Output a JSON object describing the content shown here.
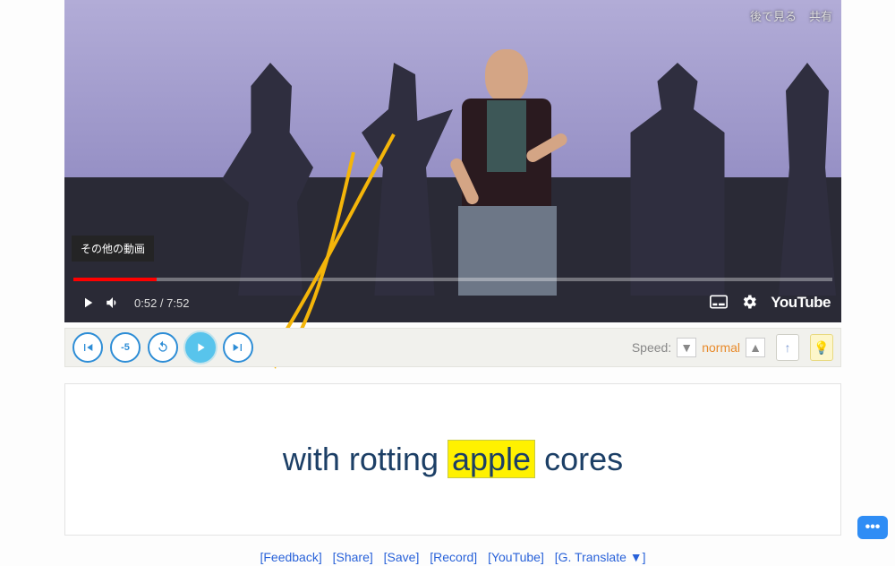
{
  "video": {
    "top_tags": {
      "watch_later": "後で見る",
      "share": "共有"
    },
    "more_videos": "その他の動画",
    "time_current": "0:52",
    "time_separator": " / ",
    "time_total": "7:52",
    "logo": "YouTube"
  },
  "controls": {
    "minus5": "-5",
    "speed_label": "Speed:",
    "speed_value": "normal",
    "up_arrow": "↑",
    "bulb": "💡",
    "dropdown_down": "▼",
    "dropdown_up": "▲"
  },
  "subtitle": {
    "pre": "with rotting ",
    "highlight": "apple",
    "post": " cores"
  },
  "footer": {
    "feedback": "[Feedback]",
    "share": "[Share]",
    "save": "[Save]",
    "record": "[Record]",
    "youtube": "[YouTube]",
    "gtranslate": "[G. Translate  ▼]"
  },
  "chat_fab": "•••"
}
